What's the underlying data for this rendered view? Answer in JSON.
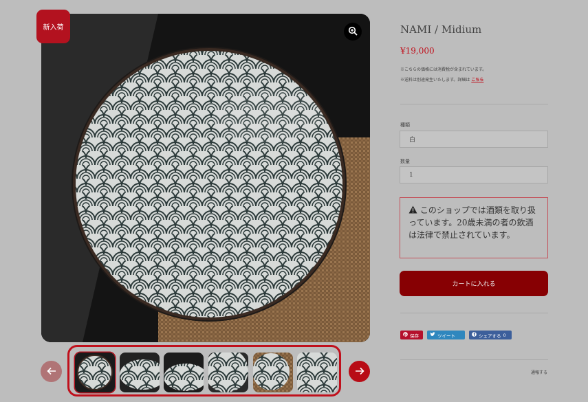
{
  "badge": {
    "label": "新入荷"
  },
  "product": {
    "title": "NAMI / Midium",
    "price": "¥19,000",
    "tax_note": "※こちらの価格には消費税が含まれています。",
    "shipping_note": "※送料は別途発生いたします。詳細は",
    "shipping_link": "こちら"
  },
  "options": {
    "type_label": "種類",
    "type_value": "白",
    "qty_label": "数量",
    "qty_value": "1"
  },
  "warning": {
    "icon": "warning-icon",
    "text": "このショップでは酒類を取り扱っています。20歳未満の者の飲酒は法律で禁止されています。"
  },
  "cart": {
    "label": "カートに入れる"
  },
  "share": {
    "pin_label": "保存",
    "tweet_label": "ツイート",
    "fb_label": "シェアする",
    "fb_count": "0"
  },
  "report": {
    "label": "通報する"
  },
  "gallery": {
    "thumb_count": 6,
    "active_index": 0
  },
  "colors": {
    "accent": "#c0101c",
    "cart": "#870003",
    "background": "#bdbdbd"
  }
}
